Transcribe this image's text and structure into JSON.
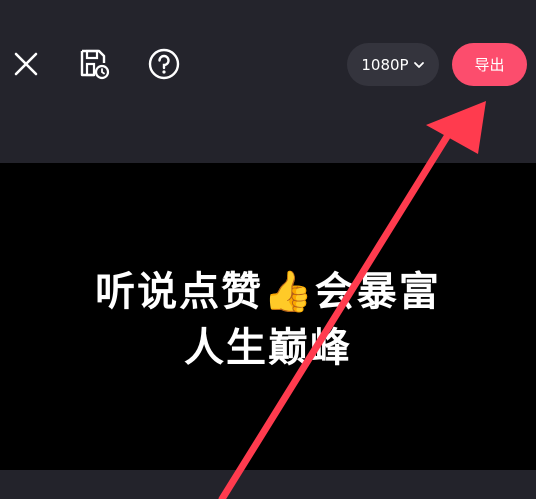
{
  "toolbar": {
    "close_icon": "close-icon",
    "save_icon": "save-draft-icon",
    "help_icon": "help-icon",
    "resolution_label": "1080P",
    "export_label": "导出"
  },
  "preview": {
    "caption_line1": "听说点赞👍会暴富",
    "caption_line2": "人生巅峰"
  },
  "colors": {
    "background": "#23232b",
    "accent": "#fc4d6d",
    "resolution_bg": "#34343d",
    "annotation_arrow": "#ff3b4e"
  }
}
